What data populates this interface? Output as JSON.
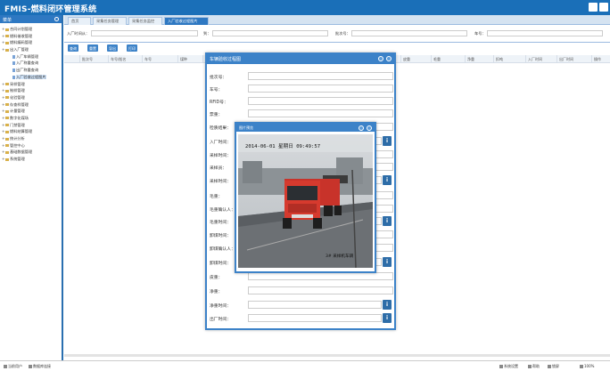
{
  "app": {
    "title": "FMIS-燃料闭环管理系统"
  },
  "sidebar": {
    "header": "菜单",
    "items": [
      {
        "label": "合同计划管理",
        "child": false,
        "selected": false
      },
      {
        "label": "燃料催收管理",
        "child": false,
        "selected": false
      },
      {
        "label": "燃料编码管理",
        "child": false,
        "selected": false
      },
      {
        "label": "出入厂管理",
        "child": false,
        "selected": false
      },
      {
        "label": "入厂车辆管理",
        "child": true,
        "selected": false
      },
      {
        "label": "入厂称重查询",
        "child": true,
        "selected": false
      },
      {
        "label": "出厂称重查询",
        "child": true,
        "selected": false
      },
      {
        "label": "入厂验收过程图片",
        "child": true,
        "selected": true
      },
      {
        "label": "采样管理",
        "child": false,
        "selected": false
      },
      {
        "label": "制样管理",
        "child": false,
        "selected": false
      },
      {
        "label": "化验管理",
        "child": false,
        "selected": false
      },
      {
        "label": "存查样管理",
        "child": false,
        "selected": false
      },
      {
        "label": "计量管理",
        "child": false,
        "selected": false
      },
      {
        "label": "数字化煤场",
        "child": false,
        "selected": false
      },
      {
        "label": "门禁管理",
        "child": false,
        "selected": false
      },
      {
        "label": "燃料结算管理",
        "child": false,
        "selected": false
      },
      {
        "label": "统计分析",
        "child": false,
        "selected": false
      },
      {
        "label": "管控中心",
        "child": false,
        "selected": false
      },
      {
        "label": "基础数据管理",
        "child": false,
        "selected": false
      },
      {
        "label": "系统管理",
        "child": false,
        "selected": false
      }
    ]
  },
  "tabs": [
    "首页",
    "采集任务管理",
    "采集任务监控",
    "入厂验收过程图片"
  ],
  "filter": {
    "l1": "入厂时间从：",
    "l2": "到：",
    "l3": "批次号：",
    "l4": "车号："
  },
  "toolbar": {
    "b1": "查询",
    "b2": "重置",
    "b3": "导出",
    "b4": "打印"
  },
  "grid": {
    "columns": [
      "批次号",
      "车号/船名",
      "车号",
      "煤种",
      "矿点名称",
      "运输单位",
      "皮重",
      "毛重",
      "净重",
      "扣吨",
      "入厂时间",
      "出厂时间",
      "操作"
    ]
  },
  "dialog": {
    "title": "车辆验收过程图",
    "fields": [
      "批次号：",
      "车号：",
      "RFID号：",
      "票重：",
      "检质结果：",
      "入厂时间：",
      "采样时间：",
      "采样员：",
      "采样时间：",
      "毛重：",
      "毛重确认人：",
      "毛重时间：",
      "卸煤时间：",
      "卸煤确认人：",
      "卸煤时间：",
      "皮重：",
      "净重：",
      "净重时间：",
      "出厂时间："
    ]
  },
  "photo": {
    "title": "图片预览",
    "timestamp": "2014-06-01 星期日 09:49:57",
    "caption": "3# 采样机车辆"
  },
  "footer": {
    "left1": "当前用户",
    "left2": "数据库连接",
    "r1": "系统设置",
    "r2": "帮助",
    "r3": "锁屏",
    "r4": "100%"
  },
  "colors": {
    "header": "#1a6fb8",
    "accent": "#3c82c8",
    "info_button": "#2e6da8"
  }
}
